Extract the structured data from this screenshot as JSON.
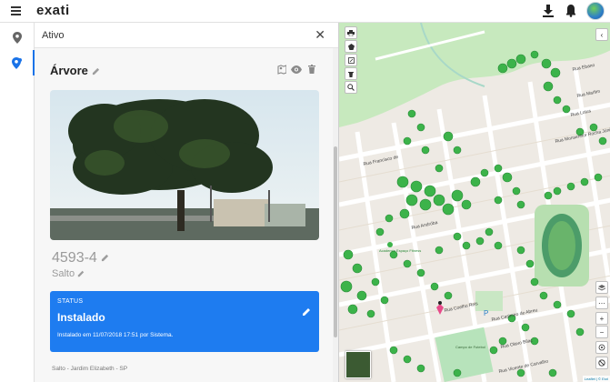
{
  "app": {
    "logo": "exati"
  },
  "panel": {
    "header_title": "Ativo",
    "asset_title": "Árvore",
    "code": "4593-4",
    "subtitle": "Salto",
    "status": {
      "label": "STATUS",
      "value": "Instalado",
      "note": "Instalado em 11/07/2018 17:51 por Sistema."
    },
    "address": "Salto - Jardim Elizabeth - SP"
  },
  "map": {
    "streets": [
      "Rua Ebano",
      "Rua Marfim",
      "Rua Lotus",
      "Rua Monsenhor Rocha Júnior",
      "Rua Francisco de",
      "Rua Andróba",
      "Academia Espaço Fitness",
      "Rua Coelho Reis",
      "Rua Casimiro de Abreu",
      "Rua Olavo Bilac",
      "Rua Vicente de Carvalho",
      "Campo de Futebol"
    ],
    "attribution": "Leaflet | © Esri",
    "colors": {
      "tree": "#3cb34a",
      "park": "#c7e9be",
      "road": "#ffffff",
      "stadium": "#4c9c69"
    }
  },
  "colors": {
    "accent": "#1e7cf0"
  }
}
